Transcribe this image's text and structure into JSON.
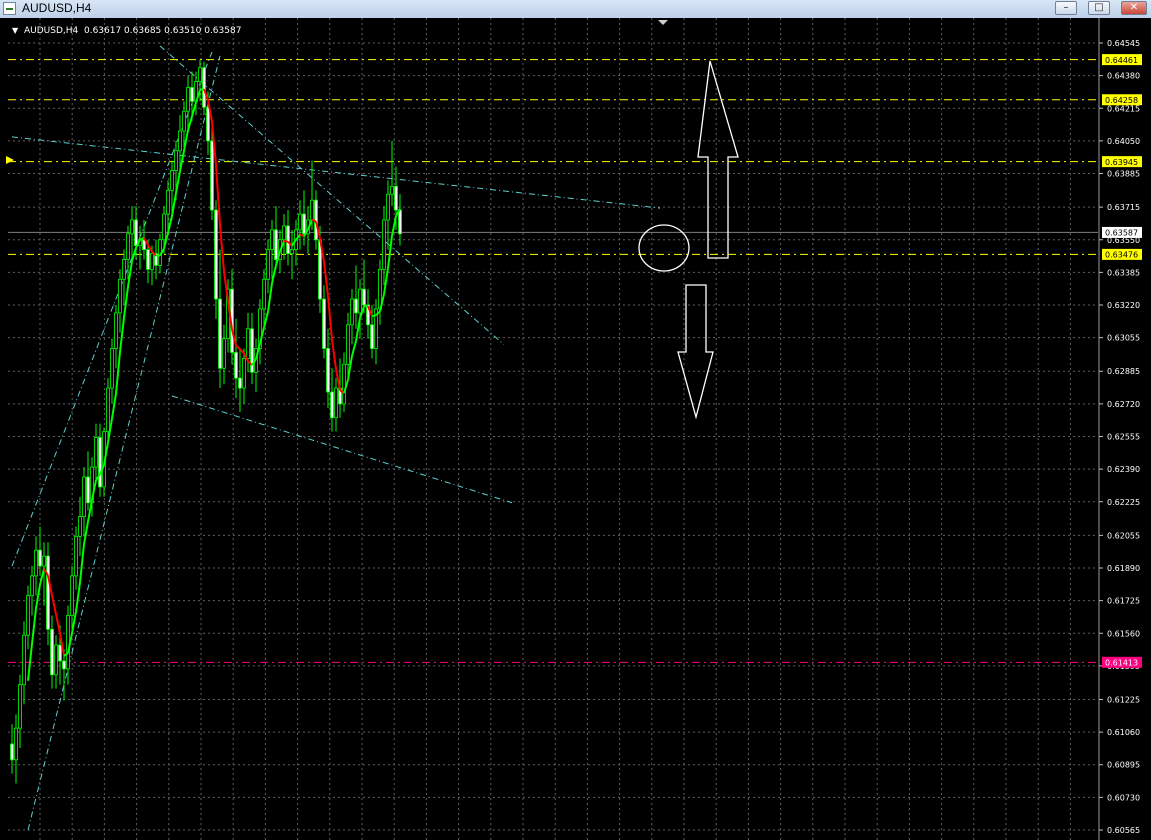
{
  "window": {
    "title": "AUDUSD,H4",
    "min_glyph": "–",
    "max_glyph": "□",
    "close_glyph": "✕"
  },
  "chart_data": {
    "type": "candlestick",
    "symbol": "AUDUSD",
    "timeframe": "H4",
    "info_line": "AUDUSD,H4  0.63617 0.63685 0.63510 0.63587",
    "ohlc": {
      "open": 0.63617,
      "high": 0.63685,
      "low": 0.6351,
      "close": 0.63587
    },
    "ylim": [
      0.60565,
      0.64545
    ],
    "grid": true,
    "background": "#000000",
    "colors": {
      "candle": "#00ff00",
      "bull_body": "#000000",
      "bear_body": "#ffffff",
      "ma_up": "#00ff00",
      "ma_down": "#ff0000",
      "grid": "#606060",
      "trendline": "#5fcfcf",
      "level_yellow": "#ffff00",
      "level_magenta": "#ff0080",
      "annotation": "#ffffff"
    },
    "y_ticks": [
      "0.64545",
      "0.64380",
      "0.64215",
      "0.64050",
      "0.63885",
      "0.63715",
      "0.63550",
      "0.63385",
      "0.63220",
      "0.63055",
      "0.62885",
      "0.62720",
      "0.62555",
      "0.62390",
      "0.62225",
      "0.62055",
      "0.61890",
      "0.61725",
      "0.61560",
      "0.61395",
      "0.61225",
      "0.61060",
      "0.60895",
      "0.60730",
      "0.60565"
    ],
    "price_labels": [
      {
        "text": "0.64461",
        "value": 0.64461,
        "color": "#ffff00"
      },
      {
        "text": "0.64258",
        "value": 0.64258,
        "color": "#ffff00"
      },
      {
        "text": "0.63945",
        "value": 0.63945,
        "color": "#ffff00"
      },
      {
        "text": "0.63587",
        "value": 0.63587,
        "color": "#ffffff"
      },
      {
        "text": "0.63476",
        "value": 0.63476,
        "color": "#ffff00"
      },
      {
        "text": "0.61413",
        "value": 0.61413,
        "color": "#ff0080"
      }
    ],
    "horizontal_levels": [
      {
        "value": 0.64461,
        "color": "#ffff00",
        "style": "dash"
      },
      {
        "value": 0.64258,
        "color": "#ffff00",
        "style": "dash"
      },
      {
        "value": 0.63945,
        "color": "#ffff00",
        "style": "dash"
      },
      {
        "value": 0.63587,
        "color": "#808080",
        "style": "solid"
      },
      {
        "value": 0.63476,
        "color": "#ffff00",
        "style": "dash"
      },
      {
        "value": 0.61413,
        "color": "#ff0080",
        "style": "dash"
      }
    ],
    "trendlines": [
      {
        "bars": [
          0,
          162
        ],
        "prices": [
          0.6407,
          0.6371
        ]
      },
      {
        "bars": [
          37,
          123
        ],
        "prices": [
          0.6453,
          0.6302
        ]
      },
      {
        "bars": [
          40,
          125
        ],
        "prices": [
          0.6276,
          0.6222
        ]
      },
      {
        "bars": [
          4,
          52
        ],
        "prices": [
          0.60565,
          0.6448
        ]
      },
      {
        "bars": [
          0,
          50
        ],
        "prices": [
          0.619,
          0.645
        ]
      }
    ],
    "candles": [
      [
        0.61,
        0.611,
        0.6085,
        0.6092
      ],
      [
        0.6092,
        0.6115,
        0.608,
        0.6108
      ],
      [
        0.6108,
        0.6135,
        0.6098,
        0.613
      ],
      [
        0.613,
        0.6162,
        0.612,
        0.6155
      ],
      [
        0.6155,
        0.618,
        0.6148,
        0.6175
      ],
      [
        0.6175,
        0.619,
        0.6165,
        0.6185
      ],
      [
        0.6185,
        0.6205,
        0.6175,
        0.6198
      ],
      [
        0.6198,
        0.621,
        0.6185,
        0.619
      ],
      [
        0.619,
        0.6202,
        0.617,
        0.6195
      ],
      [
        0.6195,
        0.6202,
        0.615,
        0.6158
      ],
      [
        0.6158,
        0.6165,
        0.6128,
        0.6135
      ],
      [
        0.6135,
        0.6155,
        0.6128,
        0.615
      ],
      [
        0.615,
        0.616,
        0.613,
        0.6142
      ],
      [
        0.6142,
        0.6148,
        0.6122,
        0.6138
      ],
      [
        0.6138,
        0.617,
        0.613,
        0.6165
      ],
      [
        0.6165,
        0.619,
        0.6158,
        0.6185
      ],
      [
        0.6185,
        0.621,
        0.6178,
        0.6205
      ],
      [
        0.6205,
        0.6225,
        0.6195,
        0.6215
      ],
      [
        0.6215,
        0.624,
        0.6205,
        0.6235
      ],
      [
        0.6235,
        0.6248,
        0.6218,
        0.6222
      ],
      [
        0.6222,
        0.6245,
        0.6215,
        0.624
      ],
      [
        0.624,
        0.6262,
        0.6232,
        0.6255
      ],
      [
        0.6255,
        0.6262,
        0.6225,
        0.623
      ],
      [
        0.623,
        0.626,
        0.6225,
        0.6258
      ],
      [
        0.6258,
        0.6285,
        0.625,
        0.628
      ],
      [
        0.628,
        0.6305,
        0.6272,
        0.63
      ],
      [
        0.63,
        0.6322,
        0.629,
        0.6318
      ],
      [
        0.6318,
        0.634,
        0.6308,
        0.6335
      ],
      [
        0.6335,
        0.635,
        0.6322,
        0.6345
      ],
      [
        0.6345,
        0.6362,
        0.6335,
        0.6358
      ],
      [
        0.6358,
        0.6372,
        0.6345,
        0.6365
      ],
      [
        0.6365,
        0.6372,
        0.6345,
        0.6352
      ],
      [
        0.6352,
        0.6362,
        0.634,
        0.6355
      ],
      [
        0.6355,
        0.6365,
        0.6345,
        0.635
      ],
      [
        0.635,
        0.6355,
        0.6333,
        0.634
      ],
      [
        0.634,
        0.6352,
        0.6332,
        0.6348
      ],
      [
        0.6348,
        0.6355,
        0.6335,
        0.6342
      ],
      [
        0.6342,
        0.6358,
        0.6338,
        0.6355
      ],
      [
        0.6355,
        0.6372,
        0.6348,
        0.6368
      ],
      [
        0.6368,
        0.6385,
        0.636,
        0.638
      ],
      [
        0.638,
        0.6395,
        0.6365,
        0.639
      ],
      [
        0.639,
        0.6405,
        0.6375,
        0.64
      ],
      [
        0.64,
        0.6418,
        0.639,
        0.641
      ],
      [
        0.641,
        0.6425,
        0.6398,
        0.642
      ],
      [
        0.642,
        0.6438,
        0.641,
        0.6432
      ],
      [
        0.6432,
        0.644,
        0.6415,
        0.6425
      ],
      [
        0.6425,
        0.644,
        0.6418,
        0.6435
      ],
      [
        0.6435,
        0.6446,
        0.6425,
        0.6442
      ],
      [
        0.6442,
        0.6445,
        0.6418,
        0.6422
      ],
      [
        0.6422,
        0.643,
        0.6398,
        0.6405
      ],
      [
        0.6405,
        0.6412,
        0.6365,
        0.637
      ],
      [
        0.637,
        0.6375,
        0.6315,
        0.6325
      ],
      [
        0.6325,
        0.635,
        0.628,
        0.629
      ],
      [
        0.629,
        0.6312,
        0.6282,
        0.6305
      ],
      [
        0.6305,
        0.6335,
        0.6298,
        0.633
      ],
      [
        0.633,
        0.634,
        0.6292,
        0.6298
      ],
      [
        0.6298,
        0.6315,
        0.6275,
        0.6285
      ],
      [
        0.6285,
        0.63,
        0.6268,
        0.628
      ],
      [
        0.628,
        0.63,
        0.6272,
        0.6295
      ],
      [
        0.6295,
        0.6318,
        0.6288,
        0.631
      ],
      [
        0.631,
        0.6318,
        0.6282,
        0.6288
      ],
      [
        0.6288,
        0.6305,
        0.6278,
        0.63
      ],
      [
        0.63,
        0.6325,
        0.6292,
        0.632
      ],
      [
        0.632,
        0.634,
        0.6312,
        0.6335
      ],
      [
        0.6335,
        0.6355,
        0.6328,
        0.635
      ],
      [
        0.635,
        0.6365,
        0.6335,
        0.636
      ],
      [
        0.636,
        0.6372,
        0.634,
        0.6345
      ],
      [
        0.6345,
        0.636,
        0.6338,
        0.6355
      ],
      [
        0.6355,
        0.6368,
        0.6345,
        0.6362
      ],
      [
        0.6362,
        0.637,
        0.6342,
        0.6348
      ],
      [
        0.6348,
        0.636,
        0.6335,
        0.635
      ],
      [
        0.635,
        0.6365,
        0.6342,
        0.636
      ],
      [
        0.636,
        0.6375,
        0.635,
        0.6368
      ],
      [
        0.6368,
        0.638,
        0.6352,
        0.6358
      ],
      [
        0.6358,
        0.6372,
        0.6348,
        0.6365
      ],
      [
        0.6365,
        0.6395,
        0.636,
        0.6375
      ],
      [
        0.6375,
        0.638,
        0.635,
        0.6355
      ],
      [
        0.6355,
        0.6362,
        0.6318,
        0.6325
      ],
      [
        0.6325,
        0.6332,
        0.6295,
        0.63
      ],
      [
        0.63,
        0.631,
        0.627,
        0.6278
      ],
      [
        0.6278,
        0.629,
        0.6258,
        0.6265
      ],
      [
        0.6265,
        0.6285,
        0.6258,
        0.628
      ],
      [
        0.628,
        0.6295,
        0.6265,
        0.6272
      ],
      [
        0.6272,
        0.6298,
        0.6268,
        0.6292
      ],
      [
        0.6292,
        0.6318,
        0.6285,
        0.6312
      ],
      [
        0.6312,
        0.633,
        0.6302,
        0.6325
      ],
      [
        0.6325,
        0.6342,
        0.631,
        0.6318
      ],
      [
        0.6318,
        0.6335,
        0.6305,
        0.633
      ],
      [
        0.633,
        0.6345,
        0.6318,
        0.6322
      ],
      [
        0.6322,
        0.633,
        0.6305,
        0.6312
      ],
      [
        0.6312,
        0.6322,
        0.6295,
        0.63
      ],
      [
        0.63,
        0.6325,
        0.6292,
        0.632
      ],
      [
        0.632,
        0.6345,
        0.6312,
        0.634
      ],
      [
        0.634,
        0.6372,
        0.6332,
        0.6365
      ],
      [
        0.6365,
        0.6385,
        0.635,
        0.6378
      ],
      [
        0.6378,
        0.6405,
        0.6372,
        0.6382
      ],
      [
        0.6382,
        0.6392,
        0.636,
        0.637
      ],
      [
        0.637,
        0.6378,
        0.6352,
        0.6358
      ]
    ],
    "ma_period": 5
  },
  "annotations": {
    "up_arrow": "up-arrow",
    "down_arrow": "down-arrow",
    "circle": "highlight-circle"
  }
}
